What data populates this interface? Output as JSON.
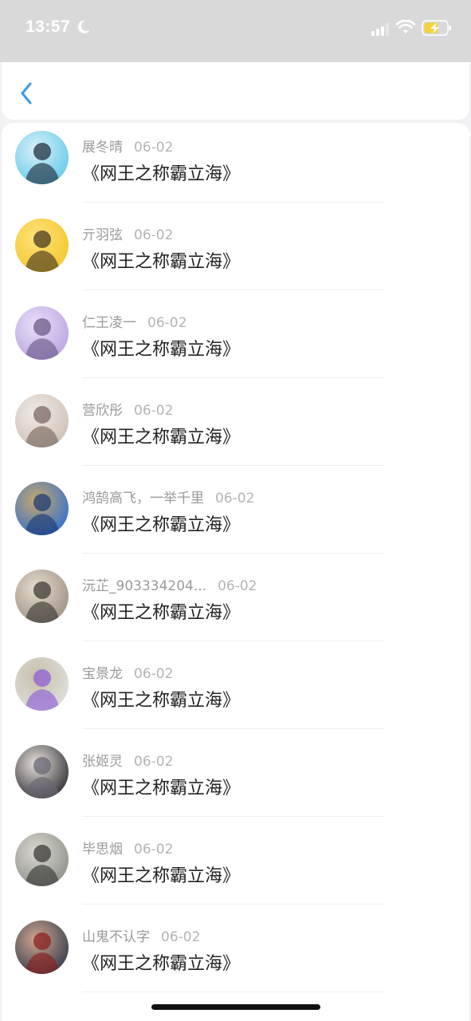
{
  "status_bar": {
    "time": "13:57"
  },
  "list": [
    {
      "name": "展冬晴",
      "date": "06-02",
      "title": "《网王之称霸立海》",
      "avatar_colors": [
        "#62c7e8",
        "#d8f1fa",
        "#203040"
      ]
    },
    {
      "name": "亓羽弦",
      "date": "06-02",
      "title": "《网王之称霸立海》",
      "avatar_colors": [
        "#f2c62a",
        "#ffe27a",
        "#4a3a20"
      ]
    },
    {
      "name": "仁王凌一",
      "date": "06-02",
      "title": "《网王之称霸立海》",
      "avatar_colors": [
        "#b9a3dd",
        "#e8defa",
        "#6a5a8a"
      ]
    },
    {
      "name": "营欣彤",
      "date": "06-02",
      "title": "《网王之称霸立海》",
      "avatar_colors": [
        "#cdbfb4",
        "#f0ebe6",
        "#7a6a60"
      ]
    },
    {
      "name": "鸿鹄高飞，一举千里",
      "date": "06-02",
      "title": "《网王之称霸立海》",
      "avatar_colors": [
        "#2d6fd2",
        "#c9a86a",
        "#1c3b74"
      ]
    },
    {
      "name": "沅芷_903334204...",
      "date": "06-02",
      "title": "《网王之称霸立海》",
      "avatar_colors": [
        "#9a8e80",
        "#e6dccd",
        "#3e3a36"
      ]
    },
    {
      "name": "宝景龙",
      "date": "06-02",
      "title": "《网王之称霸立海》",
      "avatar_colors": [
        "#e0e0e0",
        "#c8c0a8",
        "#8f5fd6"
      ]
    },
    {
      "name": "张姬灵",
      "date": "06-02",
      "title": "《网王之称霸立海》",
      "avatar_colors": [
        "#2c2a30",
        "#e8e2dc",
        "#6a6670"
      ]
    },
    {
      "name": "毕思烟",
      "date": "06-02",
      "title": "《网王之称霸立海》",
      "avatar_colors": [
        "#8a8f88",
        "#dcd8d0",
        "#3a3a38"
      ]
    },
    {
      "name": "山鬼不认字",
      "date": "06-02",
      "title": "《网王之称霸立海》",
      "avatar_colors": [
        "#2f3b4a",
        "#d0a58f",
        "#8a1f1f"
      ]
    }
  ],
  "colors": {
    "accent": "#3a9be6",
    "nav_bg": "#ffffff",
    "status_bg": "#d9d9d9"
  },
  "icons": {
    "back": "chevron-left-icon",
    "signal": "signal-icon",
    "wifi": "wifi-icon",
    "battery": "battery-charging-icon",
    "moon": "moon-icon"
  }
}
